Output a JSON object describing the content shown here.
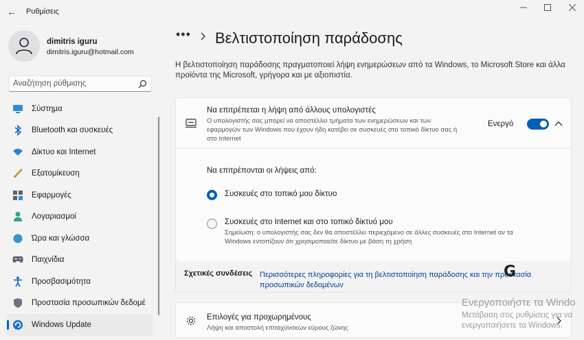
{
  "window": {
    "app_title": "Ρυθμίσεις",
    "back_glyph": "←",
    "minimize_glyph": "—",
    "maximize_glyph": "☐",
    "close_glyph": "✕"
  },
  "profile": {
    "name": "dimitris iguru",
    "email": "dimitris.iguru@hotmail.com"
  },
  "search": {
    "placeholder": "Αναζήτηση ρύθμισης"
  },
  "sidebar": {
    "items": [
      {
        "label": "Σύστημα",
        "icon": "monitor-icon",
        "active": false
      },
      {
        "label": "Bluetooth και συσκευές",
        "icon": "bluetooth-icon",
        "active": false
      },
      {
        "label": "Δίκτυο και Internet",
        "icon": "wifi-icon",
        "active": false
      },
      {
        "label": "Εξατομίκευση",
        "icon": "brush-icon",
        "active": false
      },
      {
        "label": "Εφαρμογές",
        "icon": "apps-icon",
        "active": false
      },
      {
        "label": "Λογαριασμοί",
        "icon": "person-icon",
        "active": false
      },
      {
        "label": "Ώρα και γλώσσα",
        "icon": "globe-icon",
        "active": false
      },
      {
        "label": "Παιχνίδια",
        "icon": "gamepad-icon",
        "active": false
      },
      {
        "label": "Προσβασιμότητα",
        "icon": "accessibility-icon",
        "active": false
      },
      {
        "label": "Προστασία προσωπικών δεδομέ",
        "icon": "shield-icon",
        "active": false
      },
      {
        "label": "Windows Update",
        "icon": "update-icon",
        "active": true
      }
    ]
  },
  "header": {
    "dots": "•••",
    "title": "Βελτιστοποίηση παράδοσης",
    "description": "Η βελτιστοποίηση παράδοσης πραγματοποιεί λήψη ενημερώσεων από τα Windows, το Microsoft Store και άλλα προϊόντα της Microsoft, γρήγορα και με αξιοπιστία."
  },
  "allow_card": {
    "title": "Να επιτρέπεται η λήψη από άλλους υπολογιστές",
    "description": "Ο υπολογιστής σας μπορεί να αποστέλλει τμήματα των ενημερώσεων και των εφαρμογών των Windows που έχουν ήδη κατέβει σε συσκευές στο τοπικό δίκτυο σας ή στο Internet",
    "state_label": "Ενεργό",
    "toggle_on": true,
    "downloads_from_label": "Να επιτρέπονται οι λήψεις από:",
    "options": [
      {
        "label": "Συσκευές στο τοπικό μου δίκτυο",
        "selected": true
      },
      {
        "label": "Συσκευές στο Internet και στο τοπικό δίκτυό μου",
        "selected": false,
        "note": "Σημείωση: ο υπολογιστής σας δεν θα αποστέλλει περιεχόμενο σε άλλες συσκευές στο Internet αν τα Windows εντοπίζουν ότι χρησιμοποιείτε δίκτυο με βάση τη χρήση"
      }
    ]
  },
  "related": {
    "label": "Σχετικές συνδέσεις",
    "link": "Περισσότερες πληροφορίες για τη βελτιστοποίηση παράδοσης και την προστασία προσωπικών δεδομένων"
  },
  "advanced": {
    "title": "Επιλογές για προχωρημένους",
    "description": "Λήψη και αποστολή επιταχύνσεων εύρους ζώνης"
  },
  "watermark": {
    "logo_letter": "G",
    "title": "Ενεργοποιήστε τα Windo",
    "subtitle": "Μετάβαση στις ρυθμίσεις για να ενεργοποιήσετε τα Windows."
  },
  "colors": {
    "accent": "#005fb8",
    "link": "#003e92",
    "background": "#f3f3f3",
    "card": "#fbfbfb"
  }
}
